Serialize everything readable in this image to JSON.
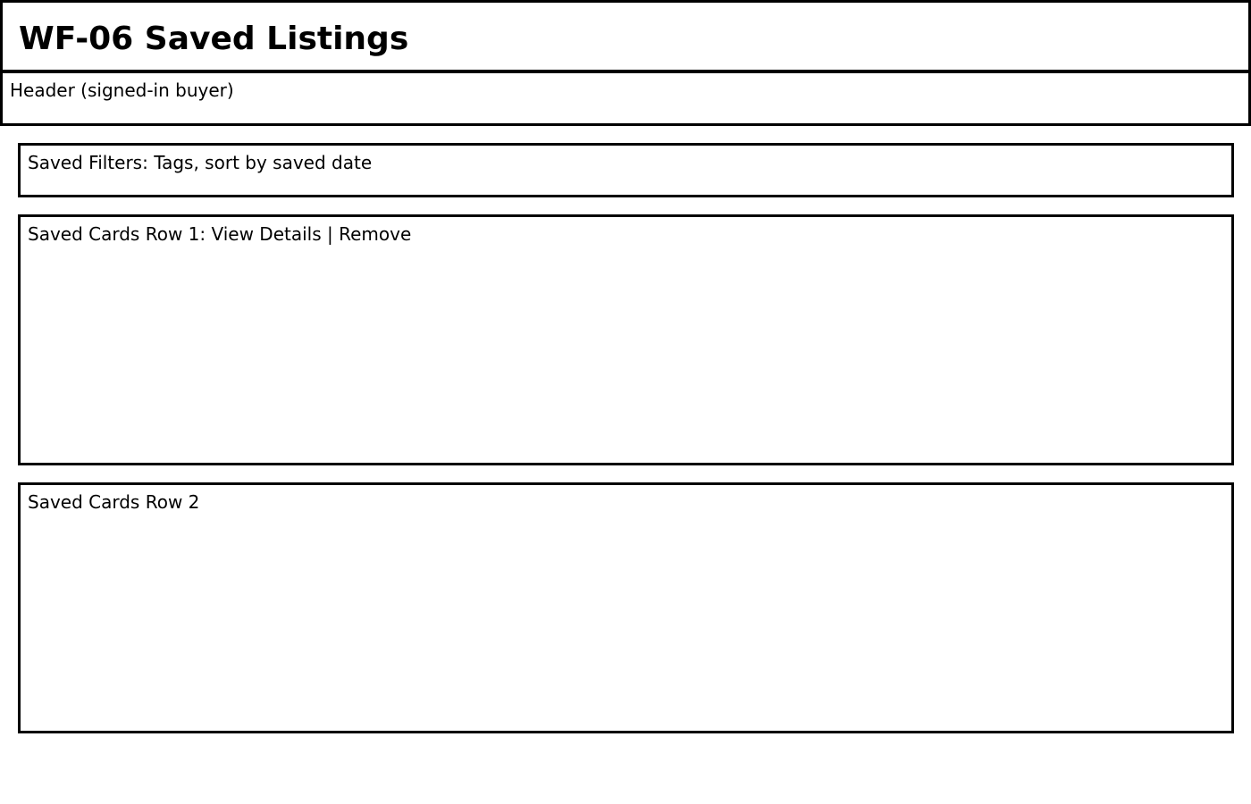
{
  "page": {
    "title": "WF-06 Saved Listings"
  },
  "regions": {
    "header": "Header (signed-in buyer)",
    "saved_filters": "Saved Filters: Tags, sort by saved date",
    "saved_cards_row_1": "Saved Cards Row 1: View Details | Remove",
    "saved_cards_row_2": "Saved Cards Row 2"
  }
}
